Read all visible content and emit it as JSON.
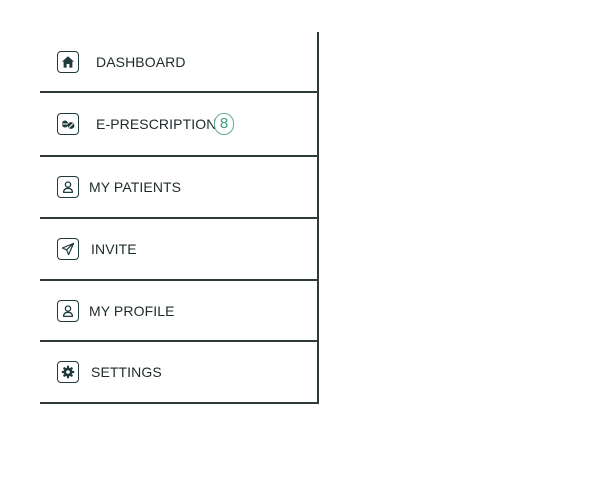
{
  "menu": {
    "items": [
      {
        "id": "dashboard",
        "label": "DASHBOARD",
        "icon": "home-icon"
      },
      {
        "id": "e-prescriptions",
        "label": "E-PRESCRIPTIONS",
        "icon": "pills-icon",
        "badge": "8"
      },
      {
        "id": "my-patients",
        "label": "MY PATIENTS",
        "icon": "user-icon"
      },
      {
        "id": "invite",
        "label": "INVITE",
        "icon": "paper-plane-icon"
      },
      {
        "id": "my-profile",
        "label": "MY PROFILE",
        "icon": "user-icon"
      },
      {
        "id": "settings",
        "label": "SETTINGS",
        "icon": "gear-icon"
      }
    ]
  },
  "colors": {
    "text": "#1d2b2b",
    "icon": "#1f3b3b",
    "border": "#2f3a3a",
    "badge": "#5fae96"
  }
}
